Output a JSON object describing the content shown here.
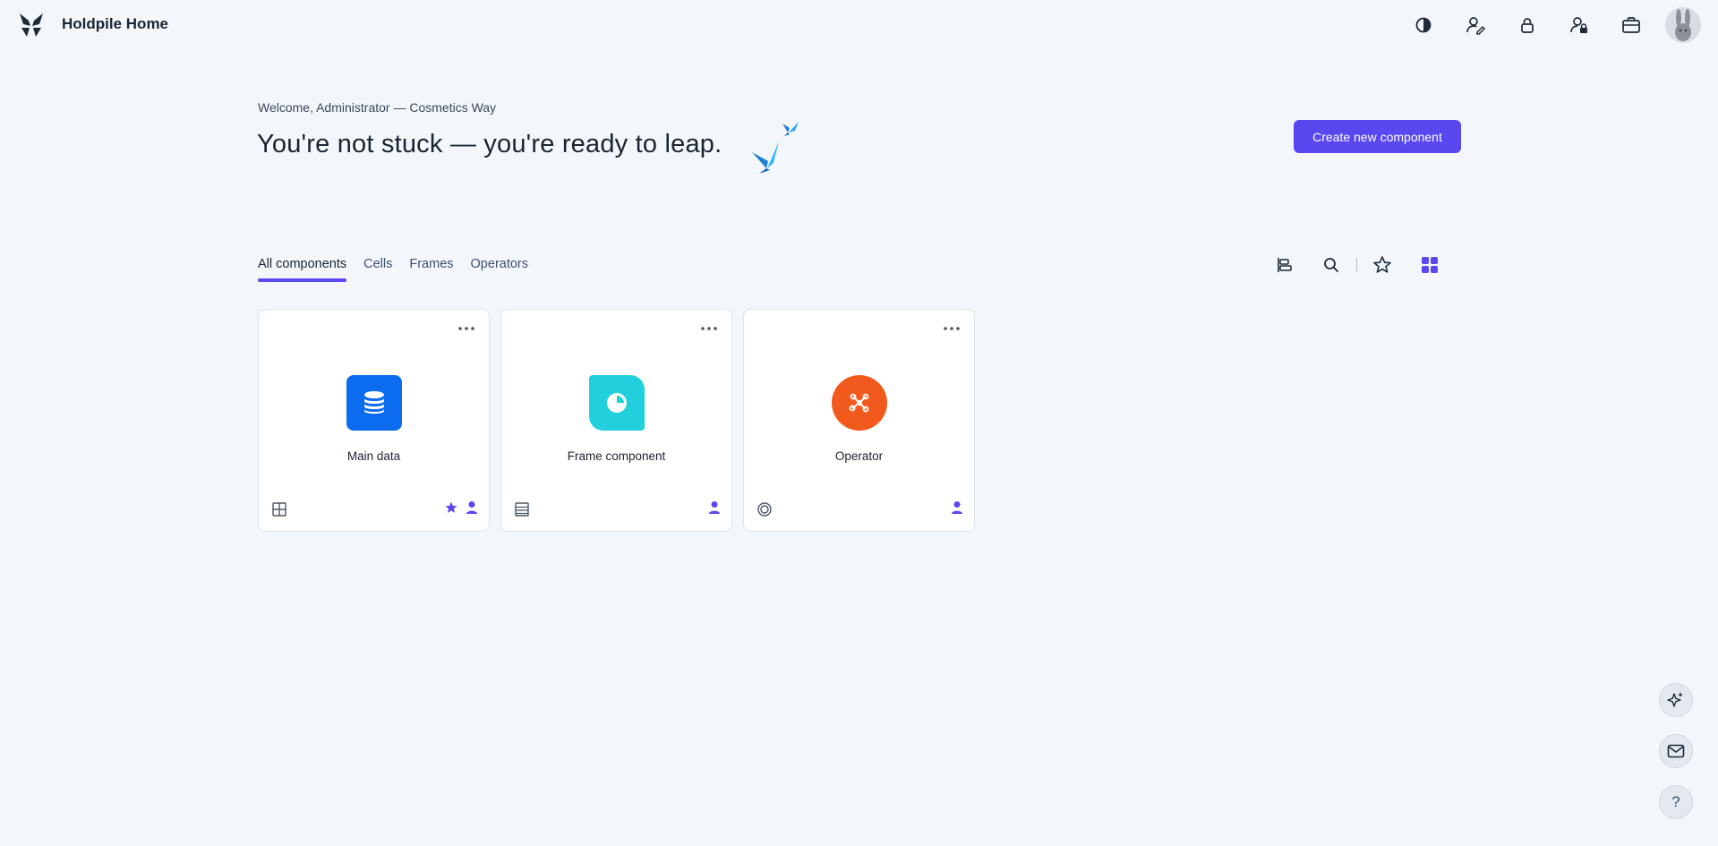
{
  "app": {
    "title": "Holdpile Home"
  },
  "header": {
    "icons": [
      "contrast-icon",
      "user-edit-icon",
      "lock-icon",
      "user-lock-icon",
      "briefcase-icon"
    ]
  },
  "hero": {
    "welcome": "Welcome, Administrator — Cosmetics Way",
    "headline": "You're not stuck — you're ready to leap.",
    "create_button": "Create new component"
  },
  "tabs": [
    {
      "label": "All components",
      "active": true
    },
    {
      "label": "Cells",
      "active": false
    },
    {
      "label": "Frames",
      "active": false
    },
    {
      "label": "Operators",
      "active": false
    }
  ],
  "cards": [
    {
      "name": "Main data",
      "tile_color": "#0b6cf0",
      "tile_icon": "database-icon",
      "type_icon": "table-grid-icon",
      "starred": true,
      "owner": true
    },
    {
      "name": "Frame component",
      "tile_color": "#21d0dc",
      "tile_icon": "pie-chart-icon",
      "type_icon": "frame-list-icon",
      "starred": false,
      "owner": true
    },
    {
      "name": "Operator",
      "tile_color": "#f25a1d",
      "tile_icon": "network-icon",
      "type_icon": "operator-ring-icon",
      "starred": false,
      "owner": true
    }
  ],
  "colors": {
    "accent": "#5b47f0",
    "background": "#f3f7fb"
  },
  "floating": {
    "help": "?"
  }
}
